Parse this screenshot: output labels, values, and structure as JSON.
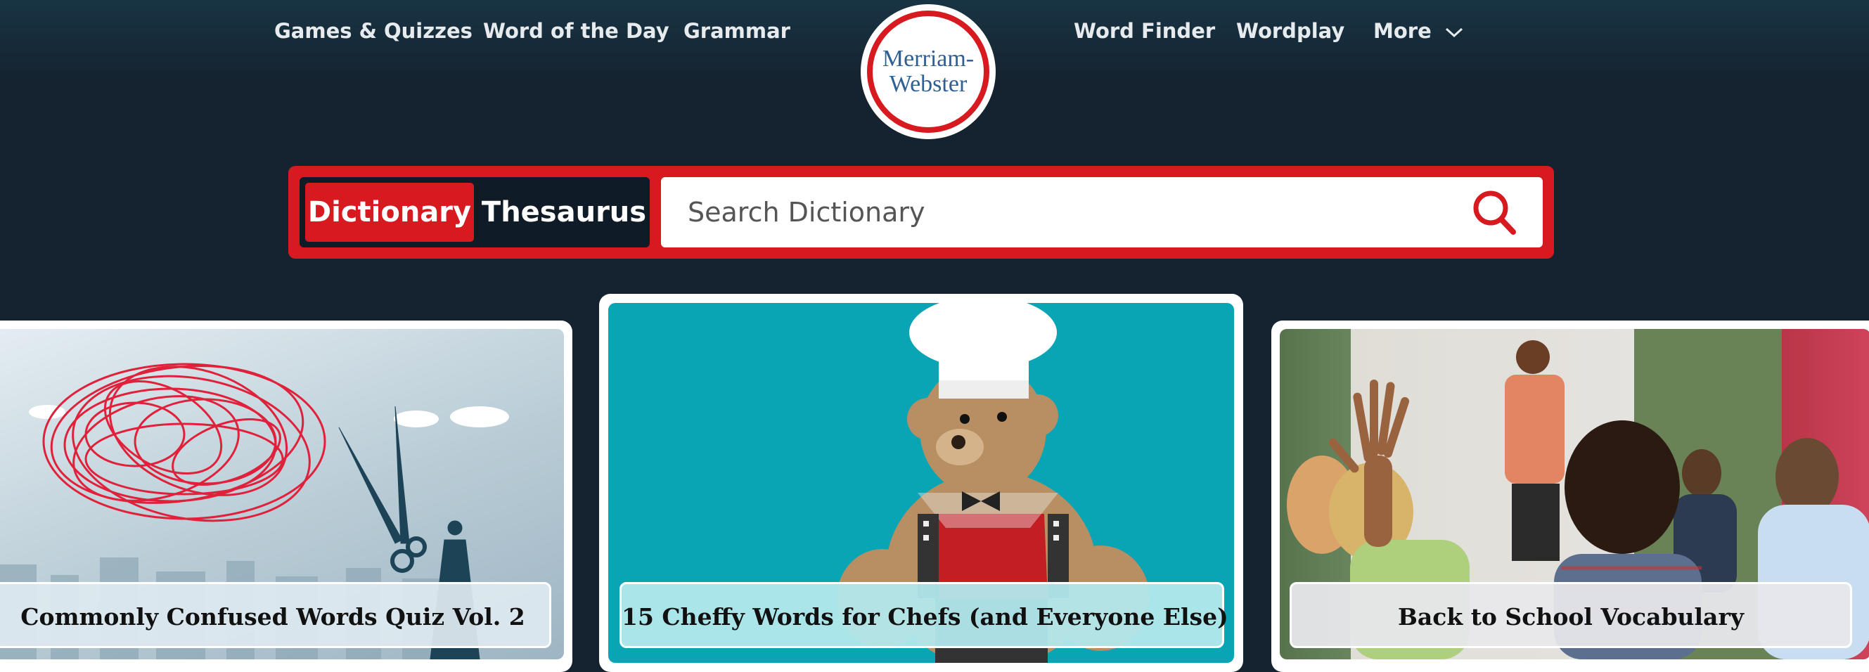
{
  "nav": {
    "left": [
      "Games & Quizzes",
      "Word of the Day",
      "Grammar"
    ],
    "right": [
      "Word Finder",
      "Wordplay",
      "More"
    ]
  },
  "logo": {
    "line1": "Merriam-",
    "line2": "Webster"
  },
  "search": {
    "tabs": [
      "Dictionary",
      "Thesaurus"
    ],
    "active_tab": "Dictionary",
    "placeholder": "Search Dictionary",
    "icon": "search-icon"
  },
  "cards": [
    {
      "title": "Commonly Confused Words Quiz Vol. 2"
    },
    {
      "title": "15 Cheffy Words for Chefs (and Everyone Else)"
    },
    {
      "title": "Back to School Vocabulary"
    }
  ],
  "colors": {
    "brand_red": "#d71920",
    "navy": "#15222f",
    "logo_blue": "#305f93"
  }
}
